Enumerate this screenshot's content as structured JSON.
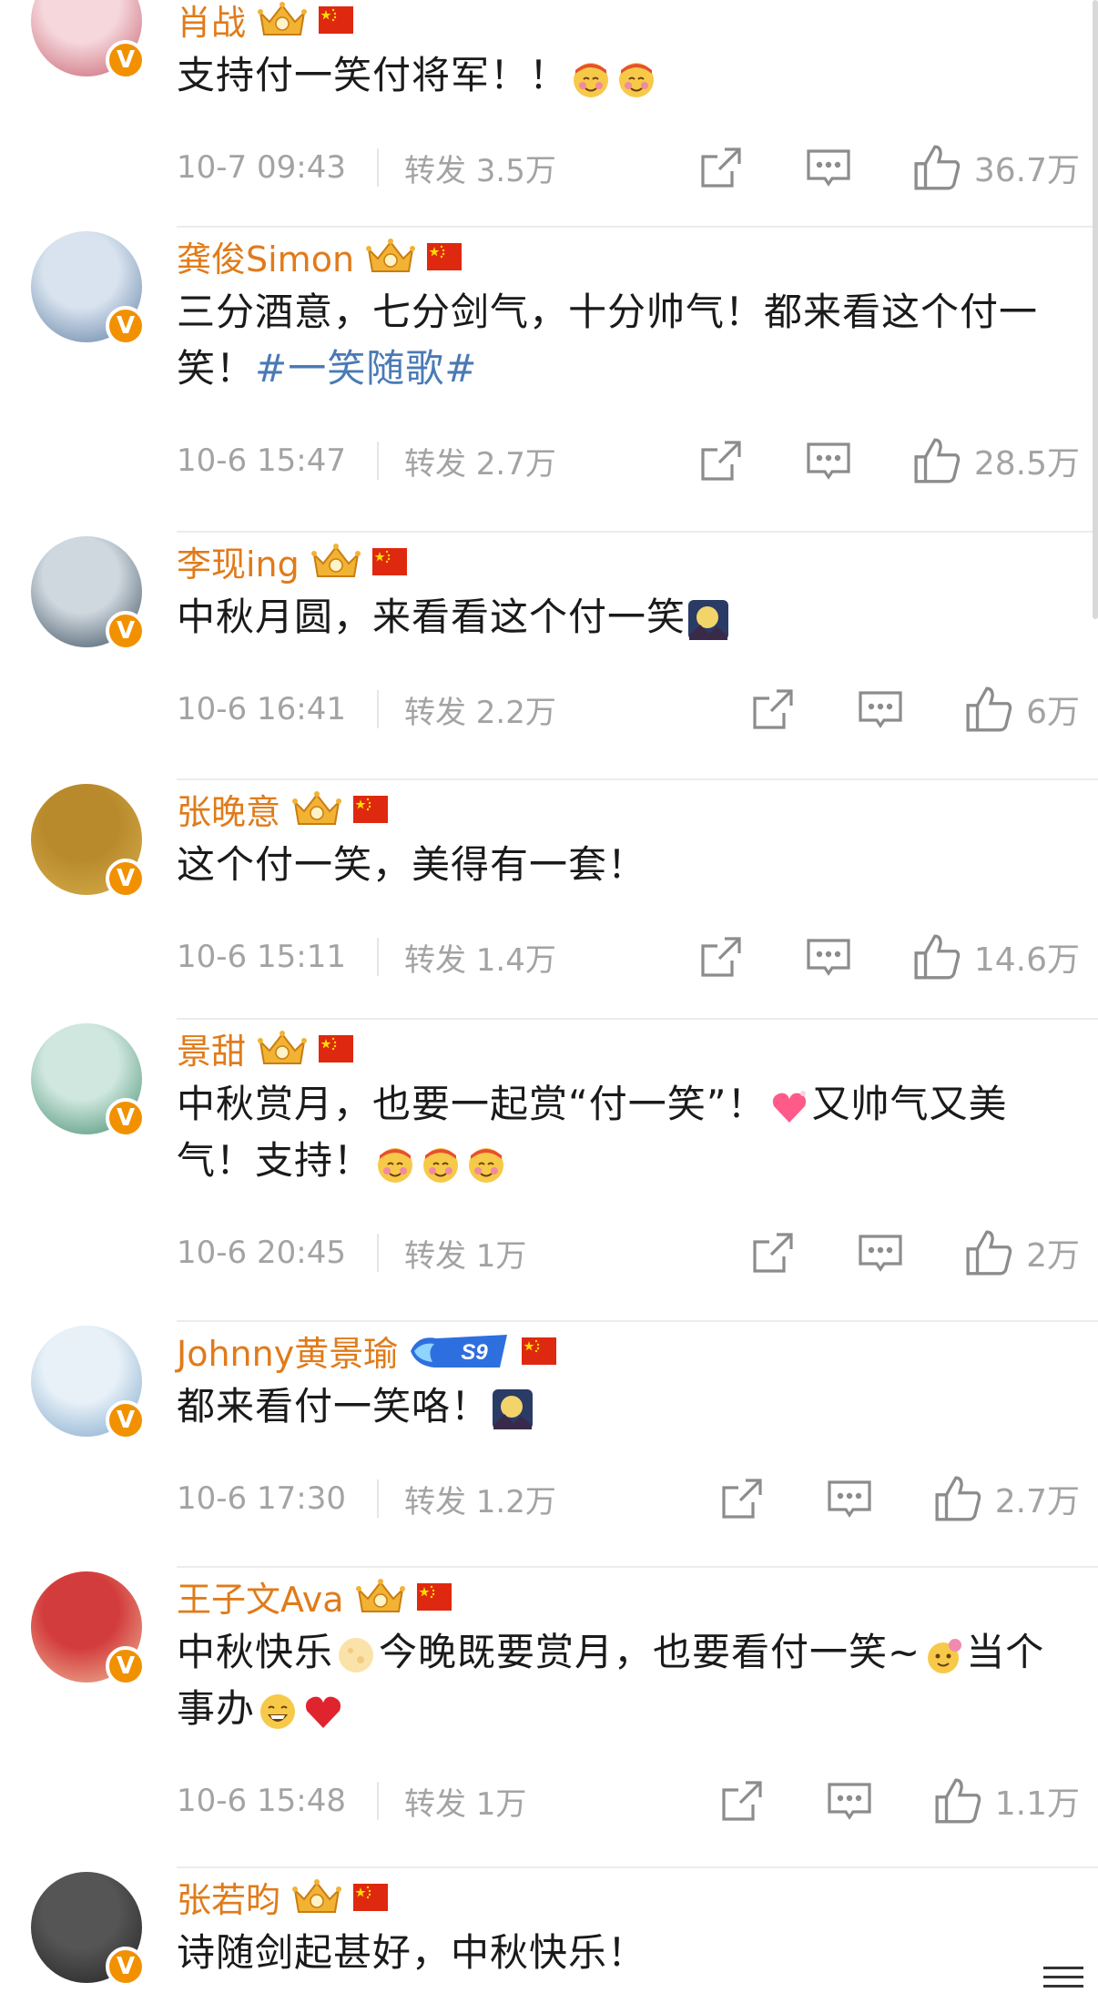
{
  "posts": [
    {
      "name": "肖战",
      "badge": "crown",
      "text_parts": [
        {
          "t": "支持付一笑付将军！！"
        }
      ],
      "emojis": [
        "smiling-face-with-blush",
        "smiling-face-with-blush"
      ],
      "time": "10-7 09:43",
      "repost": "转发 3.5万",
      "likes": "36.7万"
    },
    {
      "name": "龚俊Simon",
      "badge": "crown",
      "text_parts": [
        {
          "t": "三分酒意，七分剑气，十分帅气！都来看这个付一笑！"
        },
        {
          "tag": "#一笑随歌#"
        }
      ],
      "emojis": [],
      "time": "10-6 15:47",
      "repost": "转发 2.7万",
      "likes": "28.5万"
    },
    {
      "name": "李现ing",
      "badge": "crown",
      "text_parts": [
        {
          "t": "中秋月圆，来看看这个付一笑"
        }
      ],
      "emojis": [
        "full-moon-night"
      ],
      "time": "10-6 16:41",
      "repost": "转发 2.2万",
      "likes": "6万"
    },
    {
      "name": "张晚意",
      "badge": "crown",
      "text_parts": [
        {
          "t": "这个付一笑，美得有一套！"
        }
      ],
      "emojis": [],
      "time": "10-6 15:11",
      "repost": "转发 1.4万",
      "likes": "14.6万"
    },
    {
      "name": "景甜",
      "badge": "crown",
      "text_parts": [
        {
          "t": "中秋赏月，也要一起赏“付一笑”！"
        },
        {
          "emoji": "heart-sparkle"
        },
        {
          "t": "又帅气又美气！支持！"
        }
      ],
      "emojis": [
        "smiling-face-with-blush",
        "smiling-face-with-blush",
        "smiling-face-with-blush"
      ],
      "time": "10-6 20:45",
      "repost": "转发 1万",
      "likes": "2万"
    },
    {
      "name": "Johnny黄景瑜",
      "badge": "s9",
      "s9_label": "S9",
      "text_parts": [
        {
          "t": "都来看付一笑咯！"
        }
      ],
      "emojis": [
        "full-moon-night"
      ],
      "time": "10-6 17:30",
      "repost": "转发 1.2万",
      "likes": "2.7万"
    },
    {
      "name": "王子文Ava",
      "badge": "crown",
      "text_parts": [
        {
          "t": "中秋快乐"
        },
        {
          "emoji": "moon"
        },
        {
          "t": "今晚既要赏月，也要看付一笑~"
        },
        {
          "emoji": "flower-face"
        },
        {
          "t": "当个事办"
        },
        {
          "emoji": "laugh"
        },
        {
          "emoji": "red-heart"
        }
      ],
      "emojis": [],
      "time": "10-6 15:48",
      "repost": "转发 1万",
      "likes": "1.1万"
    },
    {
      "name": "张若昀",
      "badge": "crown",
      "text_parts": [
        {
          "t": "诗随剑起甚好，中秋快乐！"
        }
      ],
      "emojis": [],
      "time": "",
      "repost": "",
      "likes": ""
    }
  ],
  "verified_badge_letter": "V",
  "colors": {
    "name": "#e07b1a",
    "meta": "#a3a3a3",
    "tag": "#4a7ab5",
    "badge": "#f29100"
  }
}
